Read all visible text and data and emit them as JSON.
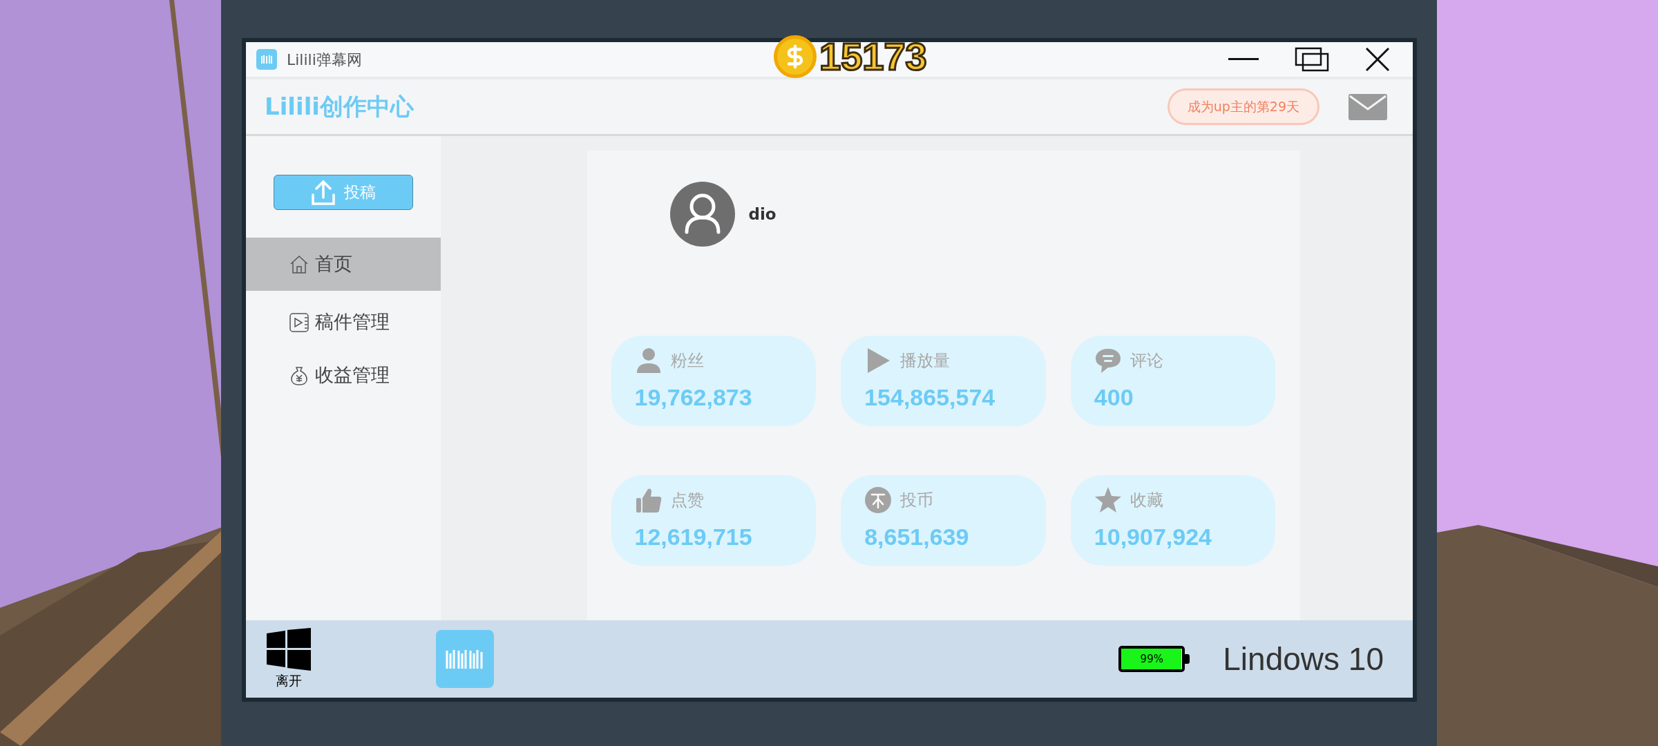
{
  "window": {
    "title": "Lilili弹幕网"
  },
  "coins": "15173",
  "header": {
    "title": "Lilili创作中心",
    "badge": "成为up主的第29天"
  },
  "sidebar": {
    "upload_button": "投稿",
    "items": [
      {
        "label": "首页",
        "kind": "home",
        "selected": true
      },
      {
        "label": "稿件管理",
        "kind": "video",
        "selected": false
      },
      {
        "label": "收益管理",
        "kind": "money",
        "selected": false
      }
    ]
  },
  "profile": {
    "name": "dio"
  },
  "stats": [
    {
      "label": "粉丝",
      "value": "19,762,873",
      "kind": "user"
    },
    {
      "label": "播放量",
      "value": "154,865,574",
      "kind": "play"
    },
    {
      "label": "评论",
      "value": "400",
      "kind": "comment"
    },
    {
      "label": "点赞",
      "value": "12,619,715",
      "kind": "like"
    },
    {
      "label": "投币",
      "value": "8,651,639",
      "kind": "coin"
    },
    {
      "label": "收藏",
      "value": "10,907,924",
      "kind": "star"
    }
  ],
  "taskbar": {
    "start_label": "离开",
    "battery": {
      "reading": "99%",
      "level": 0.99
    },
    "os_name": "Lindows 10"
  }
}
